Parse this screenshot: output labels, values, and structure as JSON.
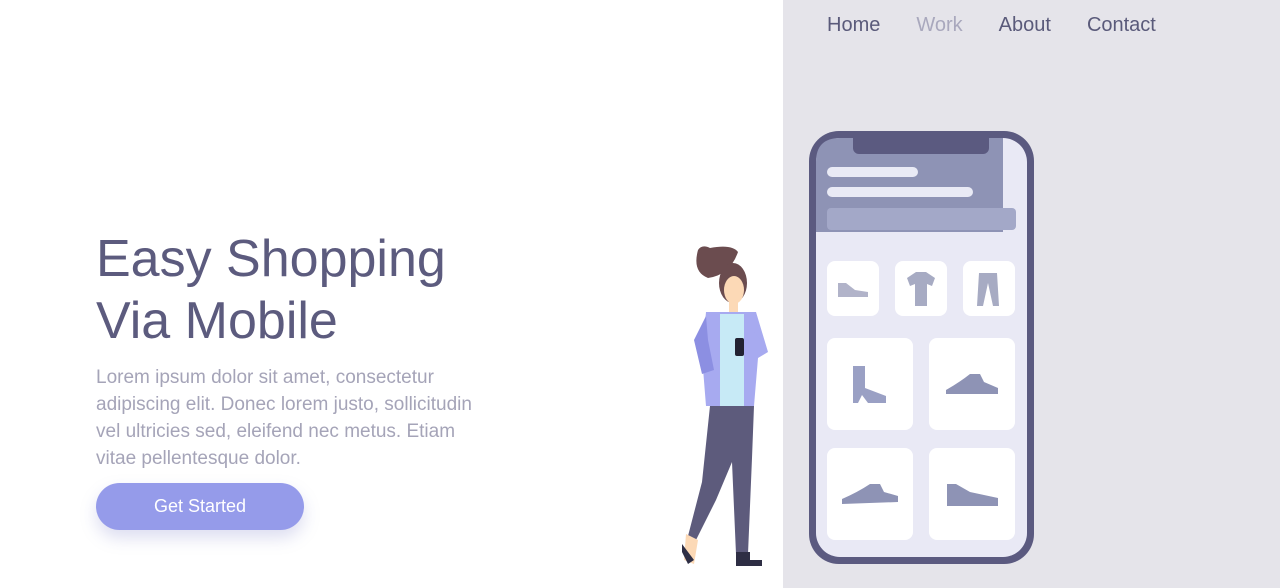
{
  "nav": {
    "items": [
      {
        "label": "Home",
        "active": false
      },
      {
        "label": "Work",
        "active": true
      },
      {
        "label": "About",
        "active": false
      },
      {
        "label": "Contact",
        "active": false
      }
    ]
  },
  "hero": {
    "title_line1": "Easy Shopping",
    "title_line2": "Via Mobile",
    "description": "Lorem ipsum dolor sit amet, consectetur adipiscing elit. Donec lorem justo, sollicitudin vel ultricies sed, eleifend nec metus. Etiam vitae pellentesque dolor.",
    "cta_label": "Get Started"
  },
  "colors": {
    "primary_text": "#5c5b7e",
    "muted_text": "#a5a4b8",
    "accent": "#959bea",
    "panel_bg": "#e5e4ea",
    "phone_frame": "#5b5a80"
  },
  "illustration": {
    "icons": [
      "woman-with-phone-icon",
      "smartphone-icon",
      "sneaker-icon",
      "tshirt-icon",
      "pants-icon",
      "boot-icon"
    ]
  }
}
